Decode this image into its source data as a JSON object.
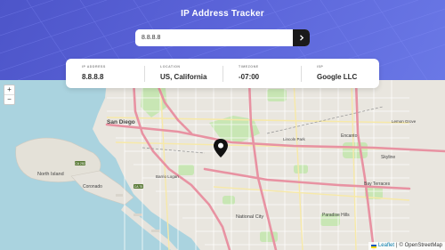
{
  "header": {
    "title": "IP Address Tracker",
    "search_value": "8.8.8.8",
    "search_button_icon": "chevron-right-icon"
  },
  "info": {
    "ip_label": "IP ADDRESS",
    "ip_value": "8.8.8.8",
    "location_label": "LOCATION",
    "location_value": "US, California",
    "timezone_label": "TIMEZONE",
    "timezone_value": "-07:00",
    "isp_label": "ISP",
    "isp_value": "Google LLC"
  },
  "map": {
    "zoom_in": "+",
    "zoom_out": "−",
    "labels": {
      "san_diego": "San Diego",
      "north_island": "North Island",
      "coronado": "Coronado",
      "encanto": "Encanto",
      "skyline": "Skyline",
      "bay_terraces": "Bay Terraces",
      "national_city": "National City",
      "paradise_hills": "Paradise Hills",
      "lemon_grove": "Lemon Grove",
      "lincoln_park": "Lincoln Park",
      "barrio_logan": "Barrio Logan"
    },
    "attribution": {
      "leaflet": "Leaflet",
      "separator": "|",
      "osm": "© OpenStreetMap"
    }
  },
  "colors": {
    "header_gradient_start": "#4d55c9",
    "header_gradient_end": "#6a78e6",
    "water": "#aad3df",
    "land": "#e9e6df",
    "park": "#c8e6b4",
    "highway": "#e892a2",
    "marker": "#111111"
  }
}
